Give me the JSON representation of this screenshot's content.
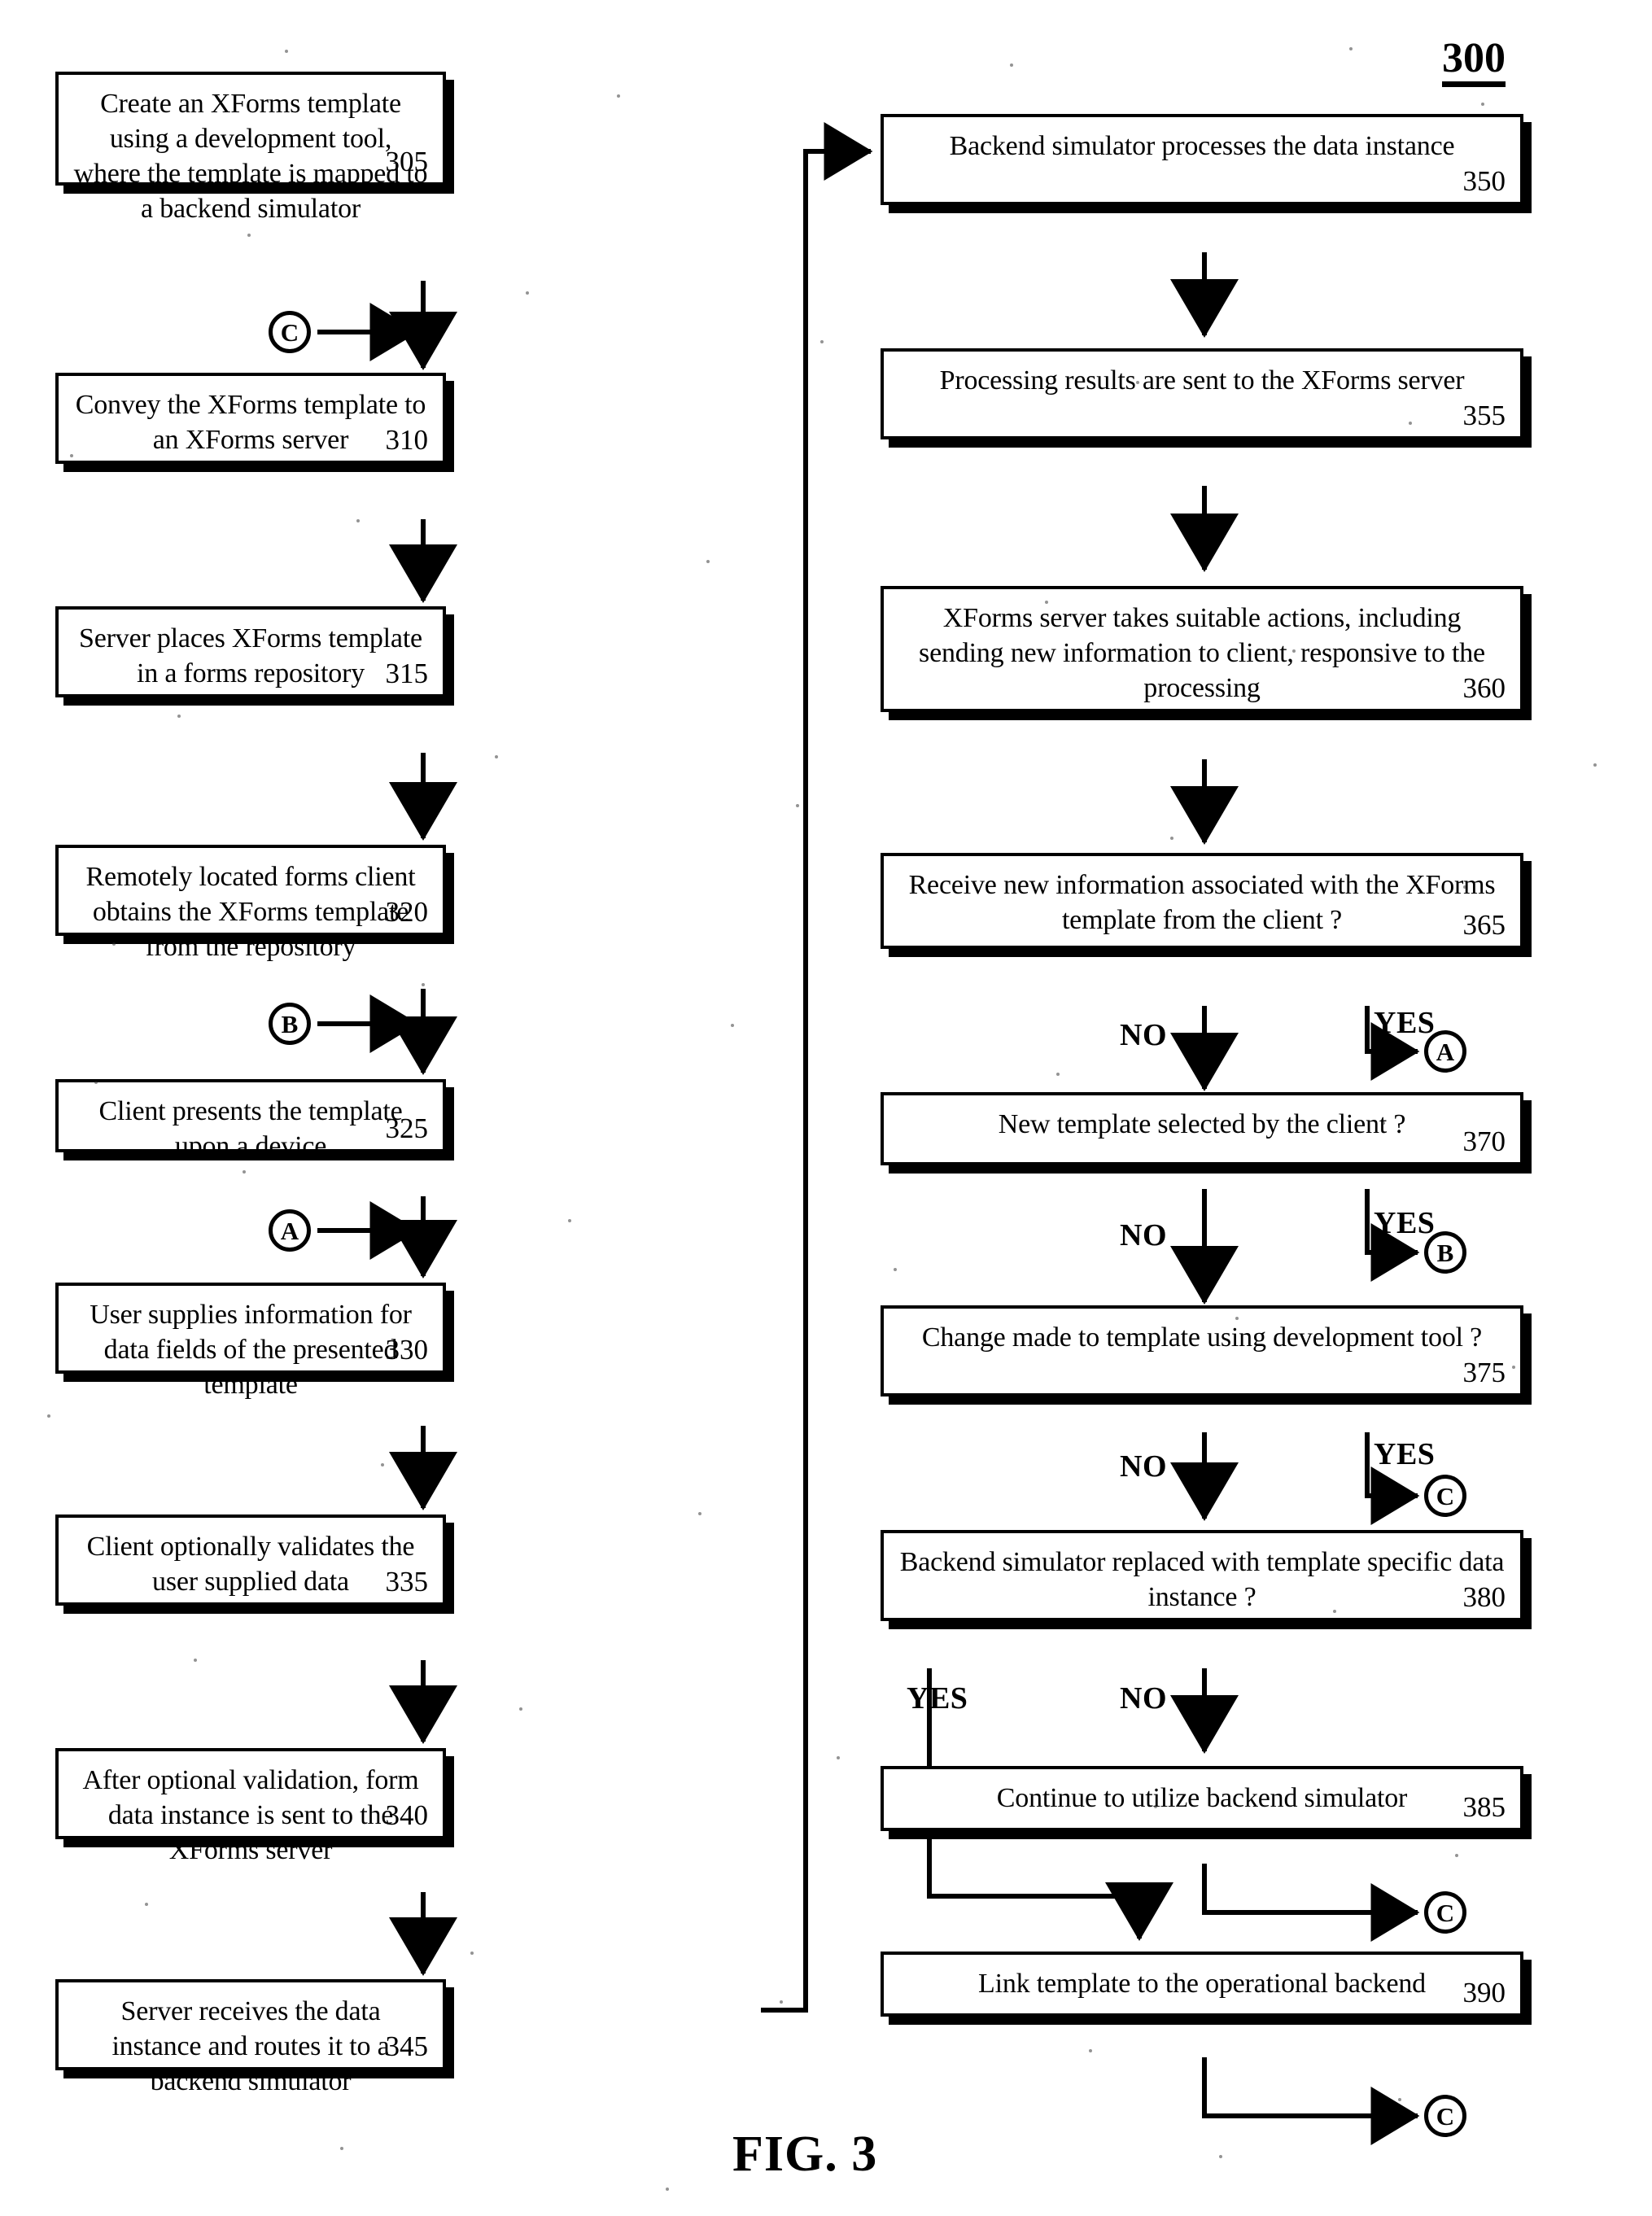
{
  "figure": {
    "reference_numeral": "300",
    "caption": "FIG. 3"
  },
  "connectors": {
    "a": "A",
    "b": "B",
    "c": "C"
  },
  "branch_labels": {
    "yes": "YES",
    "no": "NO"
  },
  "left_column": [
    {
      "id": "step-305",
      "text": "Create an XForms template using a development tool, where the template is mapped to a backend simulator",
      "number": "305"
    },
    {
      "id": "step-310",
      "text": "Convey the XForms template to an XForms server",
      "number": "310"
    },
    {
      "id": "step-315",
      "text": "Server places XForms template in a forms repository",
      "number": "315"
    },
    {
      "id": "step-320",
      "text": "Remotely located forms client obtains the XForms template from the repository",
      "number": "320"
    },
    {
      "id": "step-325",
      "text": "Client presents the template upon a device",
      "number": "325"
    },
    {
      "id": "step-330",
      "text": "User supplies information for data fields of the presented template",
      "number": "330"
    },
    {
      "id": "step-335",
      "text": "Client optionally validates the user supplied data",
      "number": "335"
    },
    {
      "id": "step-340",
      "text": "After optional validation, form data instance is sent to the XForms server",
      "number": "340"
    },
    {
      "id": "step-345",
      "text": "Server receives the data instance and routes it to a backend simulator",
      "number": "345"
    }
  ],
  "right_column": [
    {
      "id": "step-350",
      "text": "Backend simulator processes the data instance",
      "number": "350"
    },
    {
      "id": "step-355",
      "text": "Processing results are sent to the XForms server",
      "number": "355"
    },
    {
      "id": "step-360",
      "text": "XForms server takes suitable actions, including sending new information to client, responsive to the processing",
      "number": "360"
    },
    {
      "id": "step-365",
      "text": "Receive new information associated with the XForms template from the client ?",
      "number": "365"
    },
    {
      "id": "step-370",
      "text": "New template selected by the client ?",
      "number": "370"
    },
    {
      "id": "step-375",
      "text": "Change made to template using development tool ?",
      "number": "375"
    },
    {
      "id": "step-380",
      "text": "Backend simulator replaced with template specific data instance ?",
      "number": "380"
    },
    {
      "id": "step-385",
      "text": "Continue to utilize backend simulator",
      "number": "385"
    },
    {
      "id": "step-390",
      "text": "Link template to the operational backend",
      "number": "390"
    }
  ],
  "inline_connectors": {
    "into_310": "C",
    "into_325": "B",
    "into_330": "A",
    "from_365_yes": "A",
    "from_370_yes": "B",
    "from_375_yes": "C",
    "from_385": "C",
    "from_390": "C"
  },
  "colors": {
    "ink": "#000000",
    "paper": "#ffffff"
  }
}
